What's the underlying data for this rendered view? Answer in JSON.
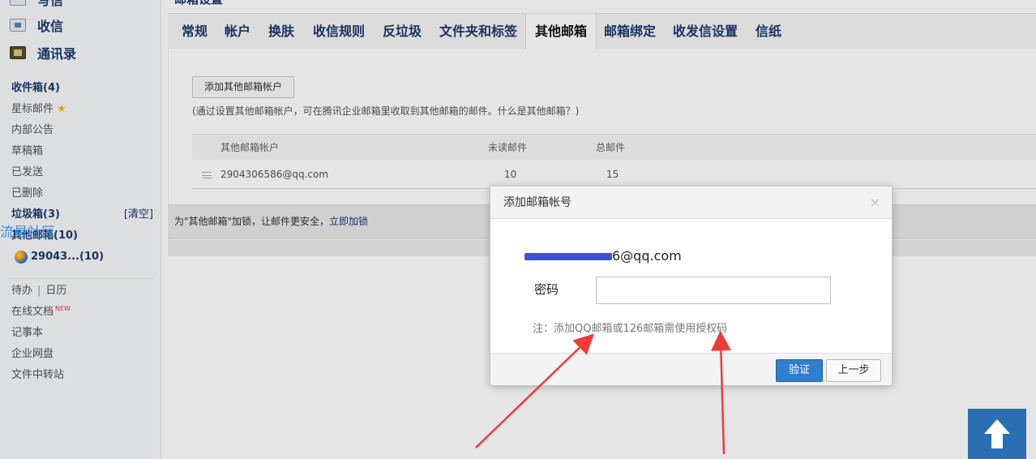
{
  "sidebar": {
    "nav": {
      "write": "写信",
      "inbox": "收信",
      "contacts": "通讯录"
    },
    "folders": [
      {
        "label": "收件箱(4)",
        "bold": true
      },
      {
        "label": "星标邮件",
        "bold": false
      },
      {
        "label": "内部公告",
        "bold": false
      },
      {
        "label": "草稿箱",
        "bold": false
      },
      {
        "label": "已发送",
        "bold": false
      },
      {
        "label": "已删除",
        "bold": false
      },
      {
        "label": "垃圾箱(3)",
        "bold": true,
        "action": "[清空]"
      },
      {
        "label": "其他邮箱(10)",
        "bold": true
      },
      {
        "label": "29043...(10)",
        "bold": true
      }
    ],
    "watermark": "流星社区",
    "tools": {
      "todo": "待办",
      "separator": "|",
      "calendar": "日历",
      "online_docs": "在线文档",
      "online_docs_badge": "NEW",
      "notepad": "记事本",
      "netdisk": "企业网盘",
      "transfer": "文件中转站"
    }
  },
  "main": {
    "page_title": "邮箱设置",
    "tabs": [
      {
        "label": "常规",
        "active": false
      },
      {
        "label": "帐户",
        "active": false
      },
      {
        "label": "换肤",
        "active": false
      },
      {
        "label": "收信规则",
        "active": false
      },
      {
        "label": "反垃圾",
        "active": false
      },
      {
        "label": "文件夹和标签",
        "active": false
      },
      {
        "label": "其他邮箱",
        "active": true
      },
      {
        "label": "邮箱绑定",
        "active": false
      },
      {
        "label": "收发信设置",
        "active": false
      },
      {
        "label": "信纸",
        "active": false
      }
    ],
    "add_button": "添加其他邮箱帐户",
    "note": "(通过设置其他邮箱帐户，可在腾讯企业邮箱里收取到其他邮箱的邮件。什么是其他邮箱？)",
    "table": {
      "headers": [
        "其他邮箱帐户",
        "未读邮件",
        "总邮件"
      ],
      "rows": [
        {
          "account": "2904306586@qq.com",
          "unread": "10",
          "total": "15"
        }
      ]
    },
    "lock_bar": {
      "text": "为\"其他邮箱\"加锁，让邮件更安全，",
      "link": "立即加锁"
    }
  },
  "dialog": {
    "title": "添加邮箱帐号",
    "close": "×",
    "email_visible": "6@qq.com",
    "password_label": "密码",
    "password_value": "",
    "note": "注：添加QQ邮箱或126邮箱需使用授权码",
    "verify_button": "验证",
    "prev_button": "上一步"
  },
  "colors": {
    "brand_blue": "#1a3a6b",
    "verify_blue": "#2f7fd0",
    "arrow_red": "#ef3b36",
    "to_top_bg": "#2a6fb4"
  }
}
